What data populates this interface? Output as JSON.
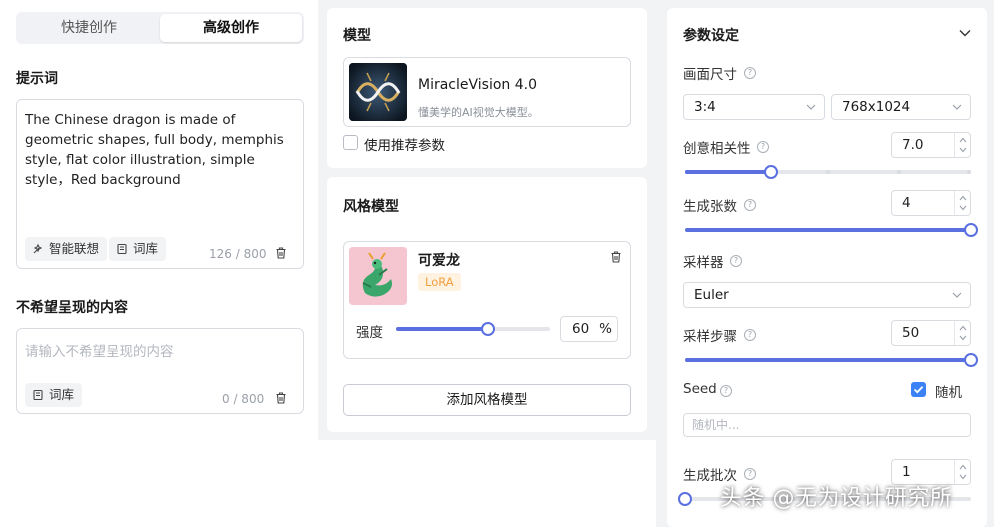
{
  "mode_tabs": {
    "quick": "快捷创作",
    "advanced": "高级创作"
  },
  "prompt": {
    "title": "提示词",
    "text": "The Chinese dragon is made of geometric shapes, full body, memphis style, flat color illustration, simple style，Red background",
    "smart_label": "智能联想",
    "lexicon_label": "词库",
    "counter": "126 / 800"
  },
  "negative": {
    "title": "不希望呈现的内容",
    "placeholder": "请输入不希望呈现的内容",
    "lexicon_label": "词库",
    "counter": "0 / 800"
  },
  "model": {
    "title": "模型",
    "name": "MiracleVision 4.0",
    "description": "懂美学的AI视觉大模型。",
    "use_recommended_label": "使用推荐参数",
    "use_recommended_checked": false
  },
  "style_model": {
    "title": "风格模型",
    "name": "可爱龙",
    "badge": "LoRA",
    "strength_label": "强度",
    "strength_value": "60",
    "strength_unit": "%",
    "strength_fraction": 0.6,
    "add_label": "添加风格模型"
  },
  "params": {
    "title": "参数设定",
    "size": {
      "label": "画面尺寸",
      "ratio": "3:4",
      "resolution": "768x1024"
    },
    "relevance": {
      "label": "创意相关性",
      "value": "7.0",
      "fraction": 0.3
    },
    "count": {
      "label": "生成张数",
      "value": "4",
      "fraction": 1.0
    },
    "sampler": {
      "label": "采样器",
      "value": "Euler"
    },
    "steps": {
      "label": "采样步骤",
      "value": "50",
      "fraction": 1.0
    },
    "seed": {
      "label": "Seed",
      "random_label": "随机",
      "random_checked": true,
      "placeholder": "随机中..."
    },
    "batch": {
      "label": "生成批次",
      "value": "1",
      "fraction": 0.0
    }
  },
  "watermark": "头条 @无为设计研究所",
  "colors": {
    "accent": "#5a6fe0",
    "checkbox_blue": "#3b82f6",
    "lora_badge": "#f0a040",
    "panel_bg": "#f2f3f5"
  },
  "icons": [
    "smart-suggest-icon",
    "lexicon-icon",
    "trash-icon",
    "chevron-down-icon",
    "help-icon",
    "check-icon"
  ]
}
